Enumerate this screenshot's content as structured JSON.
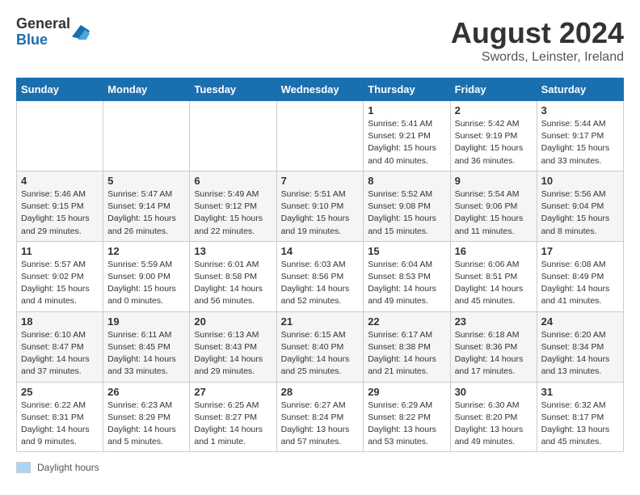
{
  "app": {
    "logo_line1": "General",
    "logo_line2": "Blue"
  },
  "title": "August 2024",
  "subtitle": "Swords, Leinster, Ireland",
  "days_of_week": [
    "Sunday",
    "Monday",
    "Tuesday",
    "Wednesday",
    "Thursday",
    "Friday",
    "Saturday"
  ],
  "footer_label": "Daylight hours",
  "weeks": [
    [
      {
        "day": "",
        "info": ""
      },
      {
        "day": "",
        "info": ""
      },
      {
        "day": "",
        "info": ""
      },
      {
        "day": "",
        "info": ""
      },
      {
        "day": "1",
        "info": "Sunrise: 5:41 AM\nSunset: 9:21 PM\nDaylight: 15 hours\nand 40 minutes."
      },
      {
        "day": "2",
        "info": "Sunrise: 5:42 AM\nSunset: 9:19 PM\nDaylight: 15 hours\nand 36 minutes."
      },
      {
        "day": "3",
        "info": "Sunrise: 5:44 AM\nSunset: 9:17 PM\nDaylight: 15 hours\nand 33 minutes."
      }
    ],
    [
      {
        "day": "4",
        "info": "Sunrise: 5:46 AM\nSunset: 9:15 PM\nDaylight: 15 hours\nand 29 minutes."
      },
      {
        "day": "5",
        "info": "Sunrise: 5:47 AM\nSunset: 9:14 PM\nDaylight: 15 hours\nand 26 minutes."
      },
      {
        "day": "6",
        "info": "Sunrise: 5:49 AM\nSunset: 9:12 PM\nDaylight: 15 hours\nand 22 minutes."
      },
      {
        "day": "7",
        "info": "Sunrise: 5:51 AM\nSunset: 9:10 PM\nDaylight: 15 hours\nand 19 minutes."
      },
      {
        "day": "8",
        "info": "Sunrise: 5:52 AM\nSunset: 9:08 PM\nDaylight: 15 hours\nand 15 minutes."
      },
      {
        "day": "9",
        "info": "Sunrise: 5:54 AM\nSunset: 9:06 PM\nDaylight: 15 hours\nand 11 minutes."
      },
      {
        "day": "10",
        "info": "Sunrise: 5:56 AM\nSunset: 9:04 PM\nDaylight: 15 hours\nand 8 minutes."
      }
    ],
    [
      {
        "day": "11",
        "info": "Sunrise: 5:57 AM\nSunset: 9:02 PM\nDaylight: 15 hours\nand 4 minutes."
      },
      {
        "day": "12",
        "info": "Sunrise: 5:59 AM\nSunset: 9:00 PM\nDaylight: 15 hours\nand 0 minutes."
      },
      {
        "day": "13",
        "info": "Sunrise: 6:01 AM\nSunset: 8:58 PM\nDaylight: 14 hours\nand 56 minutes."
      },
      {
        "day": "14",
        "info": "Sunrise: 6:03 AM\nSunset: 8:56 PM\nDaylight: 14 hours\nand 52 minutes."
      },
      {
        "day": "15",
        "info": "Sunrise: 6:04 AM\nSunset: 8:53 PM\nDaylight: 14 hours\nand 49 minutes."
      },
      {
        "day": "16",
        "info": "Sunrise: 6:06 AM\nSunset: 8:51 PM\nDaylight: 14 hours\nand 45 minutes."
      },
      {
        "day": "17",
        "info": "Sunrise: 6:08 AM\nSunset: 8:49 PM\nDaylight: 14 hours\nand 41 minutes."
      }
    ],
    [
      {
        "day": "18",
        "info": "Sunrise: 6:10 AM\nSunset: 8:47 PM\nDaylight: 14 hours\nand 37 minutes."
      },
      {
        "day": "19",
        "info": "Sunrise: 6:11 AM\nSunset: 8:45 PM\nDaylight: 14 hours\nand 33 minutes."
      },
      {
        "day": "20",
        "info": "Sunrise: 6:13 AM\nSunset: 8:43 PM\nDaylight: 14 hours\nand 29 minutes."
      },
      {
        "day": "21",
        "info": "Sunrise: 6:15 AM\nSunset: 8:40 PM\nDaylight: 14 hours\nand 25 minutes."
      },
      {
        "day": "22",
        "info": "Sunrise: 6:17 AM\nSunset: 8:38 PM\nDaylight: 14 hours\nand 21 minutes."
      },
      {
        "day": "23",
        "info": "Sunrise: 6:18 AM\nSunset: 8:36 PM\nDaylight: 14 hours\nand 17 minutes."
      },
      {
        "day": "24",
        "info": "Sunrise: 6:20 AM\nSunset: 8:34 PM\nDaylight: 14 hours\nand 13 minutes."
      }
    ],
    [
      {
        "day": "25",
        "info": "Sunrise: 6:22 AM\nSunset: 8:31 PM\nDaylight: 14 hours\nand 9 minutes."
      },
      {
        "day": "26",
        "info": "Sunrise: 6:23 AM\nSunset: 8:29 PM\nDaylight: 14 hours\nand 5 minutes."
      },
      {
        "day": "27",
        "info": "Sunrise: 6:25 AM\nSunset: 8:27 PM\nDaylight: 14 hours\nand 1 minute."
      },
      {
        "day": "28",
        "info": "Sunrise: 6:27 AM\nSunset: 8:24 PM\nDaylight: 13 hours\nand 57 minutes."
      },
      {
        "day": "29",
        "info": "Sunrise: 6:29 AM\nSunset: 8:22 PM\nDaylight: 13 hours\nand 53 minutes."
      },
      {
        "day": "30",
        "info": "Sunrise: 6:30 AM\nSunset: 8:20 PM\nDaylight: 13 hours\nand 49 minutes."
      },
      {
        "day": "31",
        "info": "Sunrise: 6:32 AM\nSunset: 8:17 PM\nDaylight: 13 hours\nand 45 minutes."
      }
    ]
  ]
}
